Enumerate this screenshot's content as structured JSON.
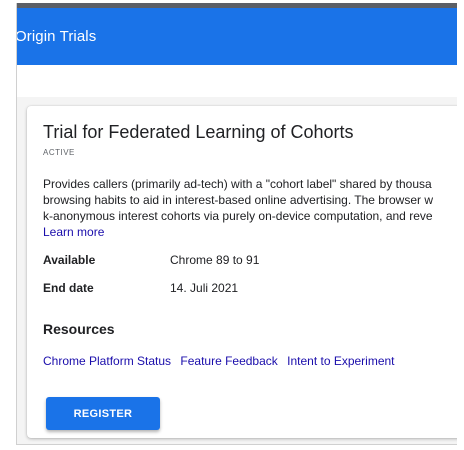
{
  "header": {
    "title": "Origin Trials"
  },
  "trial": {
    "title": "Trial for Federated Learning of Cohorts",
    "status": "ACTIVE",
    "description_lines": [
      "Provides callers (primarily ad-tech) with a \"cohort label\" shared by thousa",
      "browsing habits to aid in interest-based online advertising. The browser w",
      "k-anonymous interest cohorts via purely on-device computation, and reve"
    ],
    "learn_more": "Learn more",
    "available_label": "Available",
    "available_value": "Chrome 89 to 91",
    "end_date_label": "End date",
    "end_date_value": "14. Juli 2021"
  },
  "resources": {
    "heading": "Resources",
    "links": [
      "Chrome Platform Status",
      "Feature Feedback",
      "Intent to Experiment"
    ]
  },
  "register_button": "REGISTER",
  "colors": {
    "brand_blue": "#1a73e8",
    "link": "#1a0dab"
  }
}
